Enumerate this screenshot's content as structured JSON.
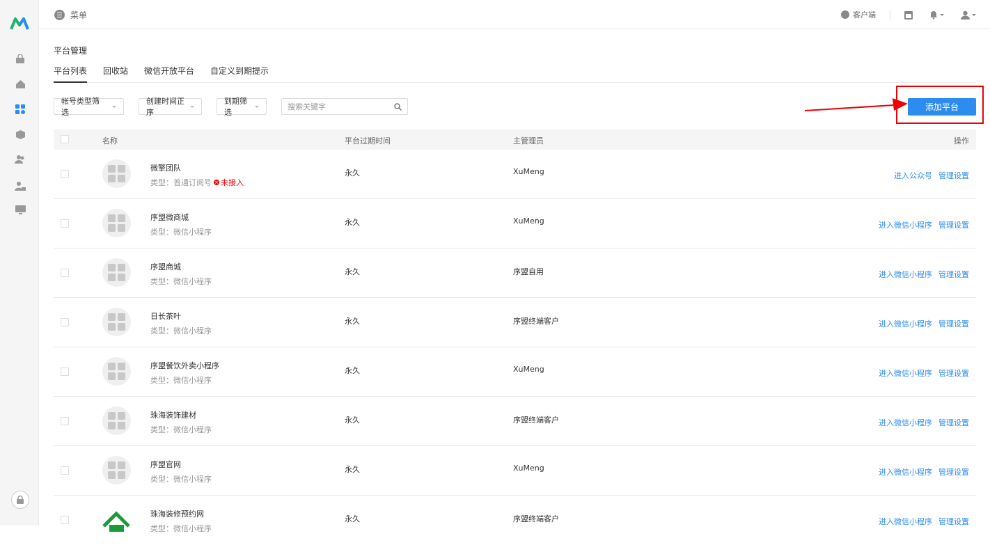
{
  "topbar": {
    "menu_label": "菜单",
    "client_label": "客户端"
  },
  "page": {
    "title": "平台管理"
  },
  "tabs": [
    {
      "label": "平台列表"
    },
    {
      "label": "回收站"
    },
    {
      "label": "微信开放平台"
    },
    {
      "label": "自定义到期提示"
    }
  ],
  "filters": {
    "account_type": "帐号类型筛选",
    "created_sort": "创建时间正序",
    "expiry_filter": "到期筛选",
    "search_placeholder": "搜索关键字"
  },
  "add_button": "添加平台",
  "table": {
    "headers": {
      "name": "名称",
      "expiry": "平台过期时间",
      "admin": "主管理员",
      "ops": "操作"
    },
    "rows": [
      {
        "name": "微擎团队",
        "type": "类型：普通订阅号",
        "status": "未接入",
        "expiry": "永久",
        "admin": "XuMeng",
        "enter": "进入公众号",
        "manage": "管理设置"
      },
      {
        "name": "序盟微商城",
        "type": "类型：微信小程序",
        "expiry": "永久",
        "admin": "XuMeng",
        "enter": "进入微信小程序",
        "manage": "管理设置"
      },
      {
        "name": "序盟商城",
        "type": "类型：微信小程序",
        "expiry": "永久",
        "admin": "序盟自用",
        "enter": "进入微信小程序",
        "manage": "管理设置"
      },
      {
        "name": "日长茶叶",
        "type": "类型：微信小程序",
        "expiry": "永久",
        "admin": "序盟终端客户",
        "enter": "进入微信小程序",
        "manage": "管理设置"
      },
      {
        "name": "序盟餐饮外卖小程序",
        "type": "类型：微信小程序",
        "expiry": "永久",
        "admin": "XuMeng",
        "enter": "进入微信小程序",
        "manage": "管理设置"
      },
      {
        "name": "珠海装饰建材",
        "type": "类型：微信小程序",
        "expiry": "永久",
        "admin": "序盟终端客户",
        "enter": "进入微信小程序",
        "manage": "管理设置"
      },
      {
        "name": "序盟官网",
        "type": "类型：微信小程序",
        "expiry": "永久",
        "admin": "XuMeng",
        "enter": "进入微信小程序",
        "manage": "管理设置"
      },
      {
        "name": "珠海装修预约网",
        "type": "类型：微信小程序",
        "expiry": "永久",
        "admin": "序盟终端客户",
        "enter": "进入微信小程序",
        "manage": "管理设置"
      }
    ]
  },
  "colors": {
    "accent": "#2d8cf0",
    "highlight": "#e00000",
    "logo_green": "#1fb36a",
    "logo_blue": "#2d8cf0"
  },
  "icons": [
    "logo-icon",
    "bag-icon",
    "home-icon",
    "apps-icon",
    "package-icon",
    "users-icon",
    "user-lock-icon",
    "monitor-icon",
    "lock-icon",
    "menu-icon",
    "globe-icon",
    "calendar-icon",
    "bell-icon",
    "user-icon",
    "search-icon"
  ]
}
